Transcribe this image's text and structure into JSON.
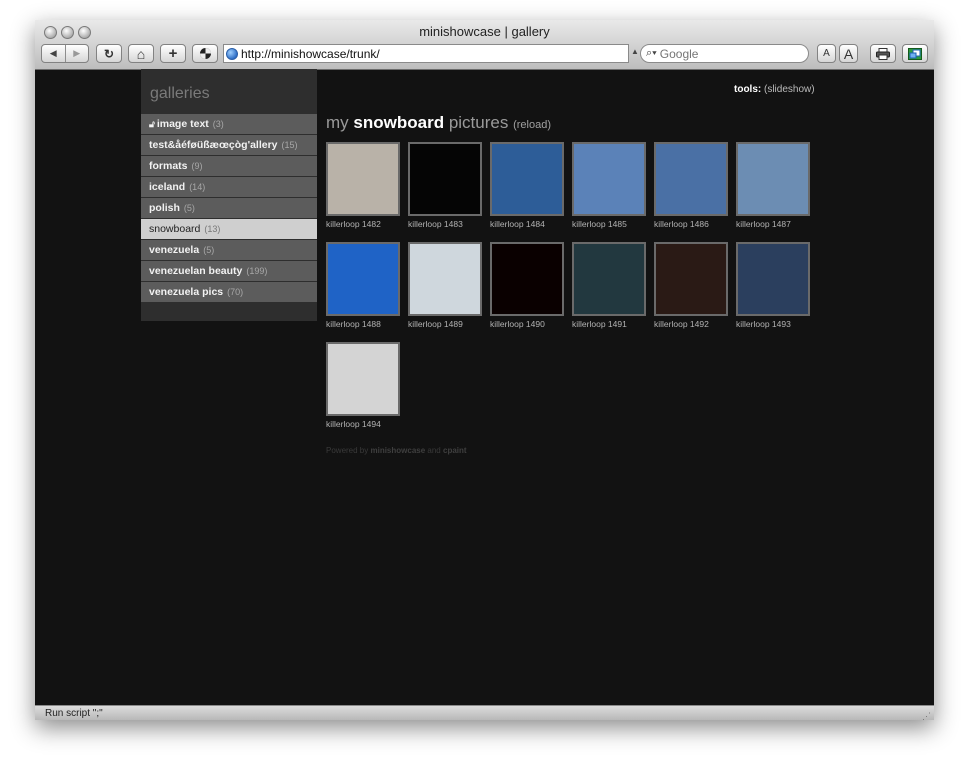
{
  "window": {
    "title": "minishowcase | gallery"
  },
  "toolbar": {
    "url": "http://minishowcase/trunk/",
    "search_placeholder": "Google",
    "back_glyph": "◀",
    "forward_glyph": "▶",
    "reload_glyph": "↻",
    "home_glyph": "⌂",
    "add_glyph": "+",
    "font_small": "A",
    "font_large": "A"
  },
  "sidebar": {
    "title": "galleries",
    "items": [
      {
        "label": "image text",
        "count": "(3)",
        "locked": true
      },
      {
        "label": "test&åéføüßæœçòg'allery",
        "count": "(15)"
      },
      {
        "label": "formats",
        "count": "(9)"
      },
      {
        "label": "iceland",
        "count": "(14)"
      },
      {
        "label": "polish",
        "count": "(5)"
      },
      {
        "label": "snowboard",
        "count": "(13)",
        "active": true
      },
      {
        "label": "venezuela",
        "count": "(5)"
      },
      {
        "label": "venezuelan beauty",
        "count": "(199)"
      },
      {
        "label": "venezuela pics",
        "count": "(70)"
      }
    ]
  },
  "tools": {
    "label": "tools:",
    "slideshow": "(slideshow)"
  },
  "heading": {
    "prefix": "my",
    "name": "snowboard",
    "suffix": "pictures",
    "reload": "(reload)"
  },
  "thumbnails": [
    "killerloop 1482",
    "killerloop 1483",
    "killerloop 1484",
    "killerloop 1485",
    "killerloop 1486",
    "killerloop 1487",
    "killerloop 1488",
    "killerloop 1489",
    "killerloop 1490",
    "killerloop 1491",
    "killerloop 1492",
    "killerloop 1493",
    "killerloop 1494"
  ],
  "thumb_colors": [
    "#b9b2a8",
    "#050505",
    "#2d5d98",
    "#5b82b8",
    "#4a70a5",
    "#6c8db3",
    "#1f63c6",
    "#cfd7dd",
    "#0a0000",
    "#22383f",
    "#2a1a15",
    "#2b3f5e",
    "#d4d4d4"
  ],
  "footer": {
    "text": "Powered by",
    "brand1": "minishowcase",
    "and": "and",
    "brand2": "cpaint"
  },
  "status": {
    "text": "Run script \";\""
  }
}
